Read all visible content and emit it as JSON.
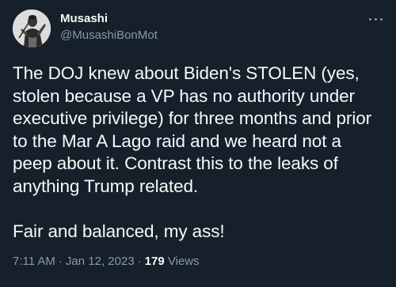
{
  "author": {
    "display_name": "Musashi",
    "handle": "@MusashiBonMot",
    "avatar_icon": "samurai-portrait-avatar"
  },
  "more_icon": "more-horizontal-icon",
  "tweet": {
    "paragraphs": [
      "The DOJ knew about Biden's STOLEN (yes, stolen because a VP has no authority under executive privilege) for three months and prior to the Mar A Lago raid and we heard not a peep about it. Contrast this to the leaks of anything Trump related.",
      "Fair and balanced, my ass!"
    ]
  },
  "meta": {
    "time": "7:11 AM",
    "separator": "·",
    "date": "Jan 12, 2023",
    "views_count": "179",
    "views_label": "Views"
  },
  "colors": {
    "background": "#15202b",
    "text_primary": "#f7f9f9",
    "text_secondary": "#8b98a5"
  }
}
